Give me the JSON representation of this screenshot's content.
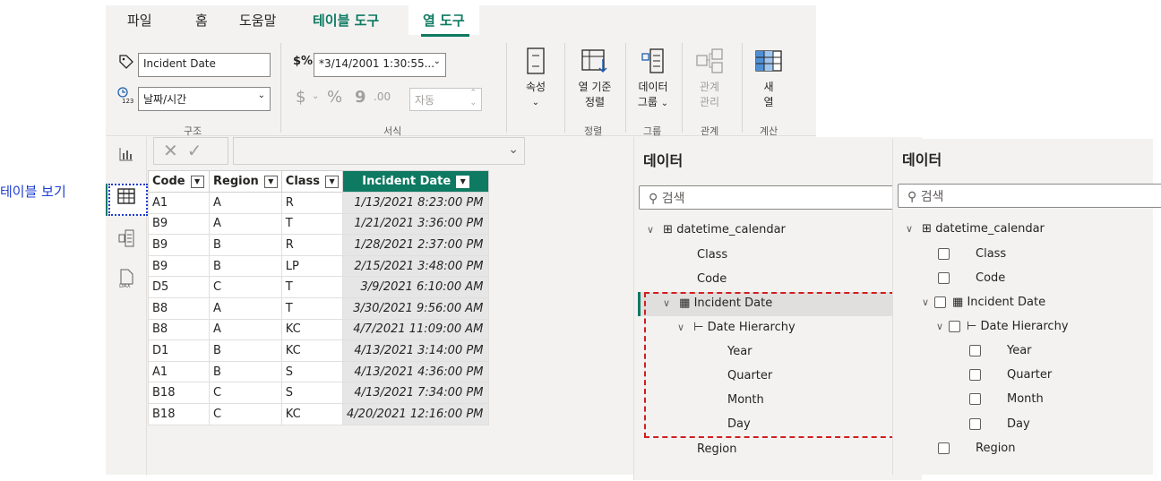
{
  "caption": "테이블 보기",
  "tabs": [
    "파일",
    "홈",
    "도움말",
    "테이블 도구",
    "열 도구"
  ],
  "ribbon": {
    "structure": {
      "name_value": "Incident Date",
      "data_type": "날짜/시간",
      "label": "구조"
    },
    "format": {
      "format_value": "*3/14/2001 1:30:55...",
      "currency": "$",
      "percent": "%",
      "comma": "9",
      "decimal": ".00",
      "auto_value": "자동",
      "label": "서식"
    },
    "properties": {
      "label": "속성"
    },
    "sort": {
      "button": "열 기준\n정렬",
      "label": "정렬"
    },
    "groups": {
      "button": "데이터\n그룹",
      "label": "그룹"
    },
    "relationships": {
      "button": "관계\n관리",
      "label": "관계"
    },
    "calculations": {
      "button": "새\n열",
      "label": "계산"
    }
  },
  "table": {
    "columns": [
      "Code",
      "Region",
      "Class",
      "Incident Date"
    ],
    "rows": [
      [
        "A1",
        "A",
        "R",
        "1/13/2021 8:23:00 PM"
      ],
      [
        "B9",
        "A",
        "T",
        "1/21/2021 3:36:00 PM"
      ],
      [
        "B9",
        "B",
        "R",
        "1/28/2021 2:37:00 PM"
      ],
      [
        "B9",
        "B",
        "LP",
        "2/15/2021 3:48:00 PM"
      ],
      [
        "D5",
        "C",
        "T",
        "3/9/2021 6:10:00 AM"
      ],
      [
        "B8",
        "A",
        "T",
        "3/30/2021 9:56:00 AM"
      ],
      [
        "B8",
        "A",
        "KC",
        "4/7/2021 11:09:00 AM"
      ],
      [
        "D1",
        "B",
        "KC",
        "4/13/2021 3:14:00 PM"
      ],
      [
        "A1",
        "B",
        "S",
        "4/13/2021 4:36:00 PM"
      ],
      [
        "B18",
        "C",
        "S",
        "4/13/2021 7:34:00 PM"
      ],
      [
        "B18",
        "C",
        "KC",
        "4/20/2021 12:16:00 PM"
      ]
    ]
  },
  "data_pane": {
    "title": "데이터",
    "search_placeholder": "검색",
    "table_name": "datetime_calendar",
    "fields": {
      "class": "Class",
      "code": "Code",
      "incident_date": "Incident Date",
      "date_hierarchy": "Date Hierarchy",
      "year": "Year",
      "quarter": "Quarter",
      "month": "Month",
      "day": "Day",
      "region": "Region"
    }
  },
  "colors": {
    "accent": "#0e7a62",
    "highlight_box": "#d11f1f",
    "caption": "#1f3ecf"
  }
}
